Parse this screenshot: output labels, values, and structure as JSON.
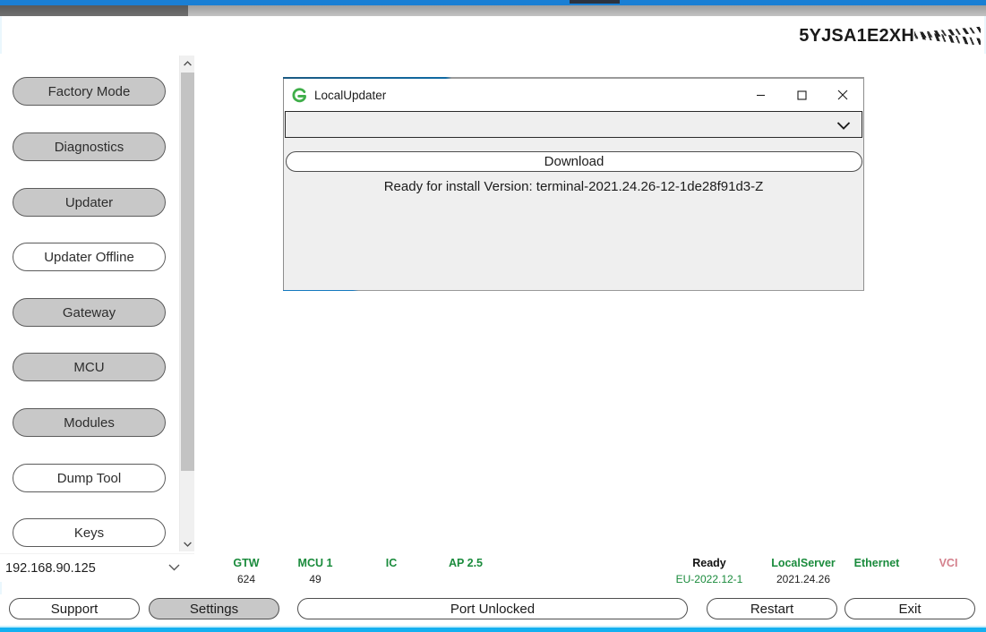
{
  "window": {
    "vin_visible": "5YJSA1E2XH",
    "vin_redacted_note": "redacted"
  },
  "sidebar": {
    "items": [
      {
        "label": "Factory Mode",
        "style": "gray"
      },
      {
        "label": "Diagnostics",
        "style": "gray"
      },
      {
        "label": "Updater",
        "style": "gray"
      },
      {
        "label": "Updater Offline",
        "style": "light"
      },
      {
        "label": "Gateway",
        "style": "gray"
      },
      {
        "label": "MCU",
        "style": "gray"
      },
      {
        "label": "Modules",
        "style": "gray"
      },
      {
        "label": "Dump Tool",
        "style": "light"
      },
      {
        "label": "Keys",
        "style": "light"
      }
    ],
    "ip_address": "192.168.90.125"
  },
  "dialog": {
    "title": "LocalUpdater",
    "icon": "localupdater-logo",
    "combo_value": "",
    "combo_placeholder": "",
    "download_label": "Download",
    "status_text": "Ready for install Version: terminal-2021.24.26-12-1de28f91d3-Z",
    "minimize_glyph": "–",
    "maximize_glyph": "□",
    "close_glyph": "✕"
  },
  "status_bar": {
    "items": [
      {
        "key": "GTW",
        "value": "624",
        "key_color": "#1a8b3c",
        "value_color": "#222222"
      },
      {
        "key": "MCU 1",
        "value": "49",
        "key_color": "#1a8b3c",
        "value_color": "#222222"
      },
      {
        "key": "IC",
        "value": "",
        "key_color": "#1a8b3c",
        "value_color": "#222222"
      },
      {
        "key": "AP 2.5",
        "value": "",
        "key_color": "#1a8b3c",
        "value_color": "#222222"
      },
      {
        "key": "Ready",
        "value": "EU-2022.12-1",
        "key_color": "#111111",
        "value_color": "#1a8b3c"
      },
      {
        "key": "LocalServer",
        "value": "2021.24.26",
        "key_color": "#1a8b3c",
        "value_color": "#222222"
      },
      {
        "key": "Ethernet",
        "value": "",
        "key_color": "#1a8b3c",
        "value_color": "#222222"
      },
      {
        "key": "VCI",
        "value": "",
        "key_color": "#d4808c",
        "value_color": "#222222"
      }
    ]
  },
  "bottom_bar": {
    "buttons": [
      {
        "label": "Support",
        "style": "light"
      },
      {
        "label": "Settings",
        "style": "gray"
      },
      {
        "label": "Port Unlocked",
        "style": "light"
      },
      {
        "label": "Restart",
        "style": "light"
      },
      {
        "label": "Exit",
        "style": "light"
      }
    ]
  },
  "colors": {
    "accent_blue": "#1a7fd4",
    "bottom_cyan": "#14b0f0",
    "status_green": "#1a8b3c",
    "button_gray": "#c8c8c8"
  }
}
